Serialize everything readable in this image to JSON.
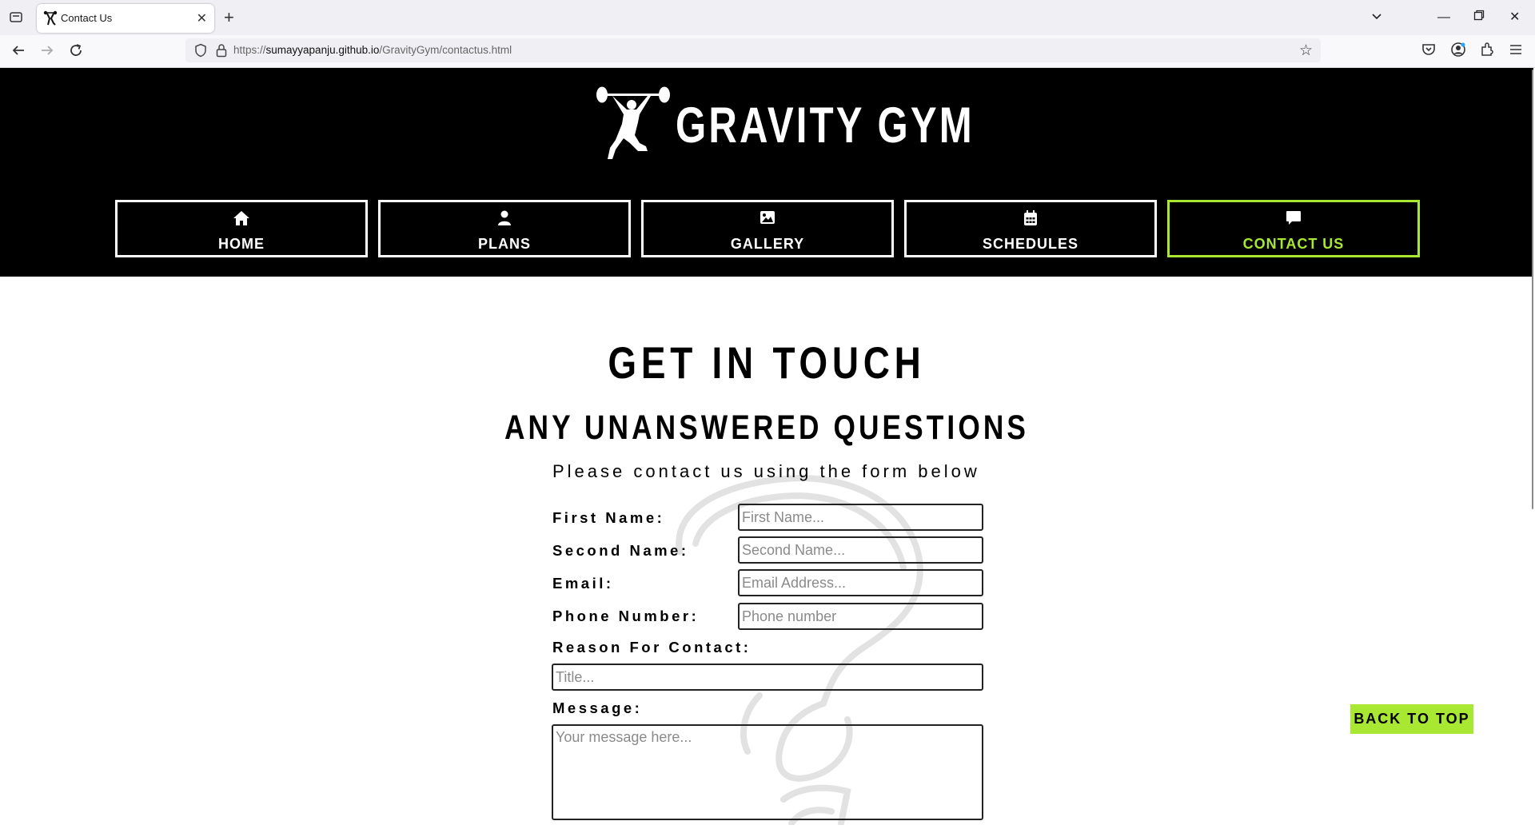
{
  "browser": {
    "tab_title": "Contact Us",
    "url_prefix": "https://",
    "url_domain": "sumayyapanju.github.io",
    "url_path": "/GravityGym/contactus.html"
  },
  "site": {
    "logo_text": "GRAVITY GYM",
    "nav": [
      {
        "label": "HOME",
        "icon": "home-icon"
      },
      {
        "label": "PLANS",
        "icon": "user-icon"
      },
      {
        "label": "GALLERY",
        "icon": "image-icon"
      },
      {
        "label": "SCHEDULES",
        "icon": "calendar-icon"
      },
      {
        "label": "CONTACT US",
        "icon": "comment-icon",
        "active": true
      }
    ]
  },
  "main": {
    "heading": "GET IN TOUCH",
    "subheading": "ANY UNANSWERED QUESTIONS",
    "intro": "Please contact us using the form below"
  },
  "form": {
    "first_name_label": "First Name:",
    "first_name_placeholder": "First Name...",
    "second_name_label": "Second Name:",
    "second_name_placeholder": "Second Name...",
    "email_label": "Email:",
    "email_placeholder": "Email Address...",
    "phone_label": "Phone Number:",
    "phone_placeholder": "Phone number",
    "reason_label": "Reason For Contact:",
    "reason_placeholder": "Title...",
    "message_label": "Message:",
    "message_placeholder": "Your message here..."
  },
  "back_to_top": "BACK TO TOP",
  "colors": {
    "accent": "#a8e832",
    "header_bg": "#000000"
  }
}
